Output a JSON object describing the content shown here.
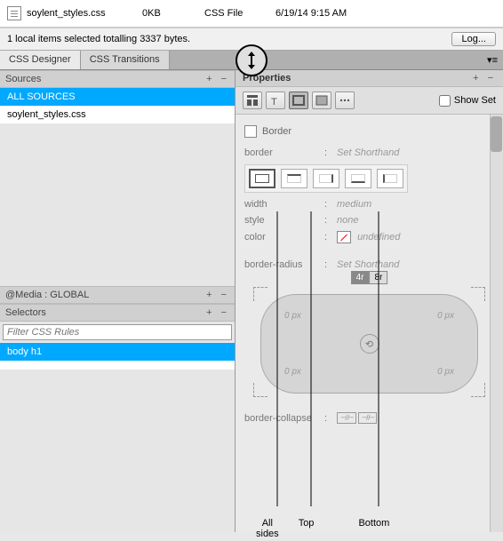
{
  "filelist": {
    "name": "soylent_styles.css",
    "size": "0KB",
    "type": "CSS File",
    "date": "6/19/14 9:15 AM"
  },
  "statusbar": {
    "msg": "1 local items selected totalling 3337 bytes.",
    "log_btn": "Log..."
  },
  "tabs": {
    "designer": "CSS Designer",
    "transitions": "CSS Transitions"
  },
  "left": {
    "sources_title": "Sources",
    "all_sources": "ALL SOURCES",
    "sheet": "soylent_styles.css",
    "media_title": "@Media : GLOBAL",
    "selectors_title": "Selectors",
    "filter_ph": "Filter CSS Rules",
    "selector": "body h1"
  },
  "props": {
    "title": "Properties",
    "show_set": "Show Set",
    "border_section": "Border",
    "border_label": "border",
    "set_shorthand": "Set Shorthand",
    "width_label": "width",
    "width_val": "medium",
    "style_label": "style",
    "style_val": "none",
    "color_label": "color",
    "color_val": "undefined",
    "radius_label": "border-radius",
    "r4": "4r",
    "r8": "8r",
    "px": "0 px",
    "collapse_label": "border-collapse"
  },
  "callouts": {
    "all": "All\nsides",
    "top": "Top",
    "bottom": "Bottom"
  }
}
